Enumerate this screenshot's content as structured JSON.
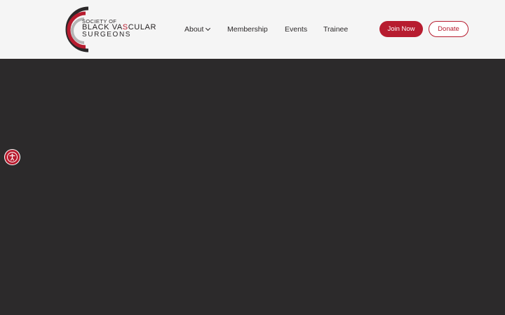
{
  "brand": {
    "logo_line1": "SOCIETY OF",
    "logo_line2_part1": "BLACK VA",
    "logo_line2_accent": "S",
    "logo_line2_part2": "CULAR",
    "logo_line3": "SURGEONS",
    "primary_color": "#b71c2f",
    "dark_color": "#2c2a2b",
    "header_bg": "#f5f5f5"
  },
  "nav": {
    "items": [
      {
        "label": "About",
        "has_dropdown": true
      },
      {
        "label": "Membership",
        "has_dropdown": false
      },
      {
        "label": "Events",
        "has_dropdown": false
      },
      {
        "label": "Trainee",
        "has_dropdown": false
      }
    ]
  },
  "actions": {
    "join_label": "Join Now",
    "donate_label": "Donate"
  },
  "accessibility": {
    "icon": "accessibility-icon"
  }
}
